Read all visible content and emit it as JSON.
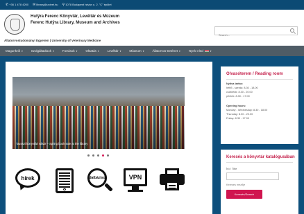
{
  "topbar": {
    "phone": "+36 1 478 4200",
    "email": "library@univet.hu",
    "address": "1078 Budapest István u. 2. \"C\" épület"
  },
  "header": {
    "title_hu": "Hutÿra Ferenc Könyvtár, Levéltár és Múzeum",
    "title_en": "Ferenc Hutÿra Library, Museum and Archives",
    "subtitle": "Állatorvostudományi Egyetem | University of Veterinary Medicine"
  },
  "search": {
    "placeholder": "Search..."
  },
  "nav": {
    "items": [
      {
        "label": "Magunkról"
      },
      {
        "label": "Szolgáltatások"
      },
      {
        "label": "Források"
      },
      {
        "label": "Oktatás"
      },
      {
        "label": "Levéltár"
      },
      {
        "label": "Múzeum"
      },
      {
        "label": "Állatorvos-történet"
      },
      {
        "label": "Nyelv nlöd"
      }
    ]
  },
  "slider": {
    "caption": "Tavaszi könyvtári vásár – Spring book sale at the library",
    "slide_count": 5,
    "active_slide": 4
  },
  "quick_links": [
    {
      "icon": "news-speech-bubble-icon",
      "label": "hírek"
    },
    {
      "icon": "e-book-tablet-icon",
      "label": ""
    },
    {
      "icon": "database-search-icon",
      "label": "adatbázisok"
    },
    {
      "icon": "vpn-monitor-icon",
      "label": "VPN"
    },
    {
      "icon": "printer-icon",
      "label": ""
    }
  ],
  "reading_room": {
    "title": "Olvasóterem / Reading room",
    "hu_heading": "Nyitva tartás:",
    "hu_lines": [
      "hétfő - szerda: 8.30 - 18.00",
      "csütörtök: 8.30 - 20.00",
      "péntek: 8.30 - 17.00"
    ],
    "en_heading": "Opening hours:",
    "en_lines": [
      "Monday - Wednesday: 8.30 - 18.00",
      "Thursday: 8.30 - 20.00",
      "Friday: 8.30 - 17.00"
    ]
  },
  "catalog": {
    "title": "Keresés a könyvtár katalógusában",
    "field_label": "Író / Title",
    "field_value": "",
    "sub": "Keresés mezője",
    "button": "Keresés/Search"
  },
  "colors": {
    "brand_blue": "#0d4f7c",
    "nav_grey": "#4f5c66",
    "accent_red": "#d0154f"
  }
}
